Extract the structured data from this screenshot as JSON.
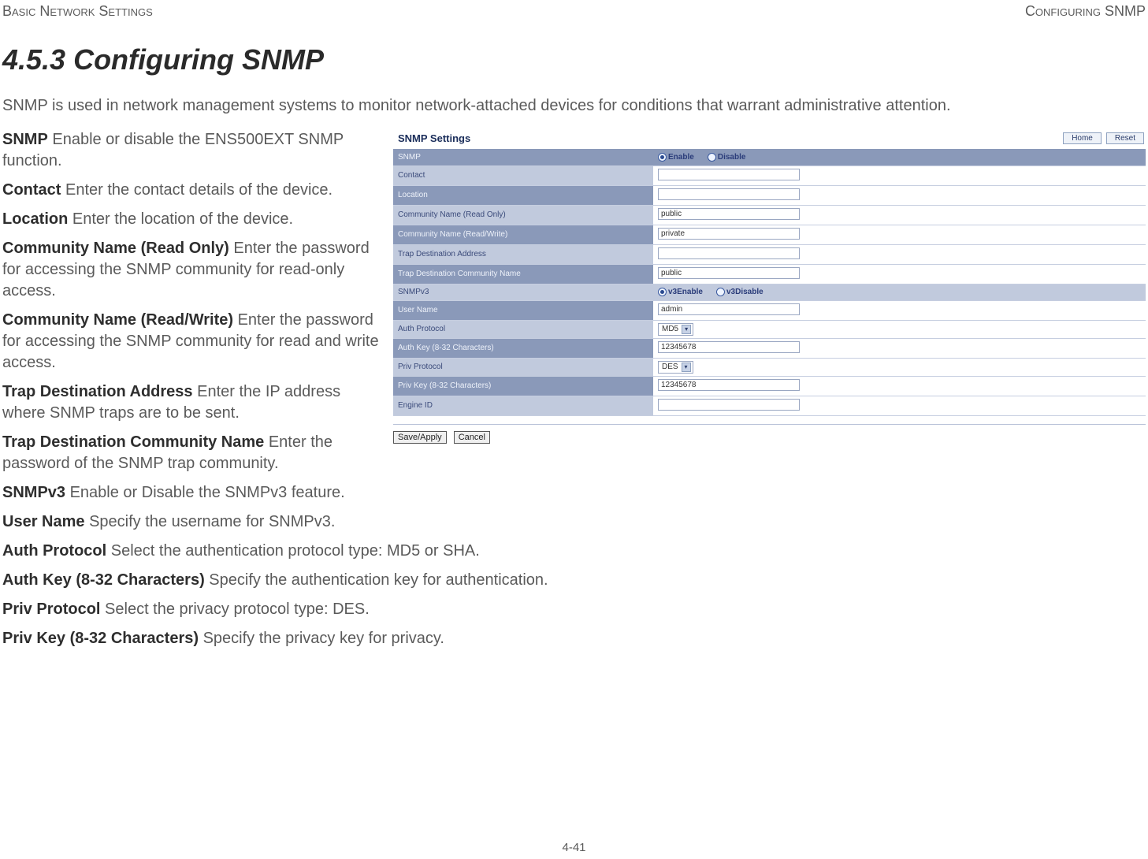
{
  "header": {
    "left": "Basic Network Settings",
    "right": "Configuring SNMP"
  },
  "section_title": "4.5.3 Configuring SNMP",
  "intro": "SNMP is used in network management systems to monitor network-attached devices for conditions that warrant administrative attention.",
  "defs": {
    "snmp": {
      "term": "SNMP",
      "desc": "  Enable or disable the ENS500EXT SNMP function."
    },
    "contact": {
      "term": "Contact",
      "desc": "  Enter the contact details of the device."
    },
    "location": {
      "term": "Location",
      "desc": "  Enter the location of the device."
    },
    "comm_ro": {
      "term": "Community Name (Read Only)",
      "desc": "  Enter the password for accessing the SNMP community for read-only access."
    },
    "comm_rw": {
      "term": "Community Name (Read/Write)",
      "desc": "  Enter the password for accessing the SNMP community for read and write access."
    },
    "trap_addr": {
      "term": "Trap Destination Address",
      "desc": "  Enter the IP address where SNMP traps are to be sent."
    },
    "trap_comm": {
      "term": "Trap Destination Community Name",
      "desc": "  Enter the password of the SNMP trap community."
    },
    "snmpv3": {
      "term": "SNMPv3",
      "desc": "  Enable or Disable the SNMPv3 feature."
    },
    "user_name": {
      "term": "User Name",
      "desc": "  Specify the username for SNMPv3."
    },
    "auth_proto": {
      "term": "Auth Protocol",
      "desc": "  Select the authentication protocol type: MD5 or SHA."
    },
    "auth_key": {
      "term": "Auth Key (8-32 Characters)",
      "desc": "  Specify the authentication key for authentication."
    },
    "priv_proto": {
      "term": "Priv Protocol",
      "desc": "  Select the privacy protocol type: DES."
    },
    "priv_key": {
      "term": "Priv Key (8-32 Characters)",
      "desc": "  Specify the privacy key for privacy."
    }
  },
  "figure": {
    "title": "SNMP Settings",
    "home_btn": "Home",
    "reset_btn": "Reset",
    "rows": {
      "snmp": "SNMP",
      "contact": "Contact",
      "location": "Location",
      "comm_ro": "Community Name (Read Only)",
      "comm_rw": "Community Name (Read/Write)",
      "trap_addr": "Trap Destination Address",
      "trap_comm": "Trap Destination Community Name",
      "snmpv3": "SNMPv3",
      "user_name": "User Name",
      "auth_proto": "Auth Protocol",
      "auth_key": "Auth Key (8-32 Characters)",
      "priv_proto": "Priv Protocol",
      "priv_key": "Priv Key (8-32 Characters)",
      "engine_id": "Engine ID"
    },
    "radios": {
      "enable": "Enable",
      "disable": "Disable",
      "v3enable": "v3Enable",
      "v3disable": "v3Disable"
    },
    "values": {
      "contact": "",
      "location": "",
      "comm_ro": "public",
      "comm_rw": "private",
      "trap_addr": "",
      "trap_comm": "public",
      "user_name": "admin",
      "auth_proto": "MD5",
      "auth_key": "12345678",
      "priv_proto": "DES",
      "priv_key": "12345678",
      "engine_id": ""
    },
    "save_btn": "Save/Apply",
    "cancel_btn": "Cancel"
  },
  "page_number": "4-41"
}
